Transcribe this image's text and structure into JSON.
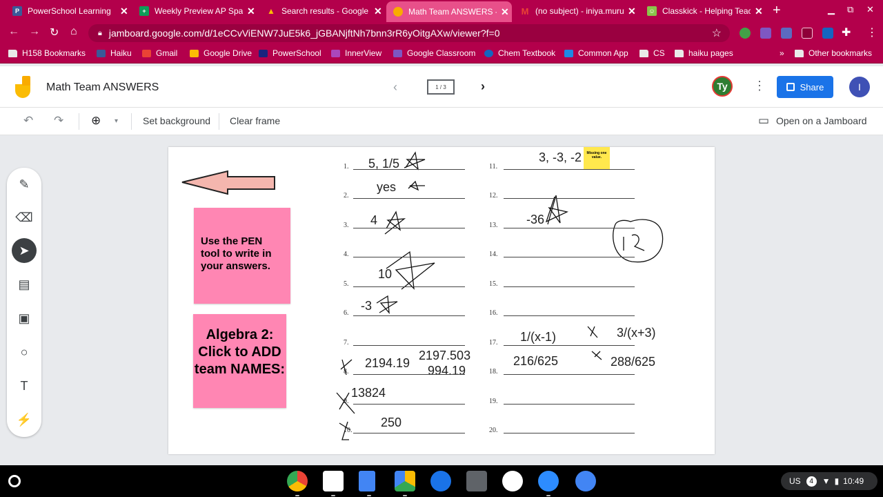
{
  "tabs": [
    {
      "title": "PowerSchool Learning",
      "favicon": "powerschool-icon",
      "color": "#3b5998",
      "glyph": "P"
    },
    {
      "title": "Weekly Preview AP Span",
      "favicon": "sheets-icon",
      "color": "#0f9d58",
      "glyph": "+"
    },
    {
      "title": "Search results - Google D",
      "favicon": "drive-icon",
      "color": "#fbbc04",
      "glyph": "▲"
    },
    {
      "title": "Math Team ANSWERS -",
      "favicon": "jamboard-icon",
      "color": "#f9ab00",
      "glyph": "●"
    },
    {
      "title": "(no subject) - iniya.muru",
      "favicon": "gmail-icon",
      "color": "#ea4335",
      "glyph": "M"
    },
    {
      "title": "Classkick - Helping Teac",
      "favicon": "classkick-icon",
      "color": "#8bc34a",
      "glyph": "☺"
    }
  ],
  "address": {
    "url": "jamboard.google.com/d/1eCCvViENW7JuE5k6_jGBANjftNh7bnn3rR6yOitgAXw/viewer?f=0"
  },
  "bookmarks": [
    {
      "label": "H158 Bookmarks",
      "icon": "folder-icon"
    },
    {
      "label": "Haiku",
      "icon": "haiku-icon"
    },
    {
      "label": "Gmail",
      "icon": "gmail-icon"
    },
    {
      "label": "Google Drive",
      "icon": "drive-icon"
    },
    {
      "label": "PowerSchool",
      "icon": "powerschool-icon"
    },
    {
      "label": "InnerView",
      "icon": "innerview-icon"
    },
    {
      "label": "Google Classroom",
      "icon": "classroom-icon"
    },
    {
      "label": "Chem Textbook",
      "icon": "textbook-icon"
    },
    {
      "label": "Common App",
      "icon": "commonapp-icon"
    },
    {
      "label": "CS",
      "icon": "folder-icon"
    },
    {
      "label": "haiku pages",
      "icon": "folder-icon"
    },
    {
      "label": "Other bookmarks",
      "icon": "folder-icon"
    }
  ],
  "bookmarks_more": "»",
  "jam": {
    "title": "Math Team ANSWERS",
    "frame_indicator": "1 / 3",
    "avatar_ty": "Ty",
    "share_label": "Share",
    "avatar_i": "I"
  },
  "toolbar": {
    "set_background": "Set background",
    "clear_frame": "Clear frame",
    "open_jamboard": "Open on a Jamboard"
  },
  "notes": {
    "pen_note": "Use the PEN tool to write in your answers.",
    "team_note": "Algebra 2: Click to ADD team NAMES:",
    "missing_note": "Missing one value."
  },
  "questions_left": [
    "1.",
    "2.",
    "3.",
    "4.",
    "5.",
    "6.",
    "7.",
    "8.",
    "9.",
    "10."
  ],
  "questions_right": [
    "11.",
    "12.",
    "13.",
    "14.",
    "15.",
    "16.",
    "17.",
    "18.",
    "19.",
    "20."
  ],
  "answers": {
    "q1": "5, 1/5",
    "q2": "yes",
    "q3": "4",
    "q5": "10",
    "q6": "-3",
    "q8a": "2194.19",
    "q8b": "2197.503",
    "q8c": "994.19",
    "q9": "13824",
    "q10": "250",
    "q11": "3, -3, -2",
    "q13": "-36",
    "q17a": "1/(x-1)",
    "q17b": "3/(x+3)",
    "q18a": "216/625",
    "q18b": "288/625"
  },
  "tray": {
    "locale": "US",
    "notifications": "4",
    "time": "10:49"
  }
}
